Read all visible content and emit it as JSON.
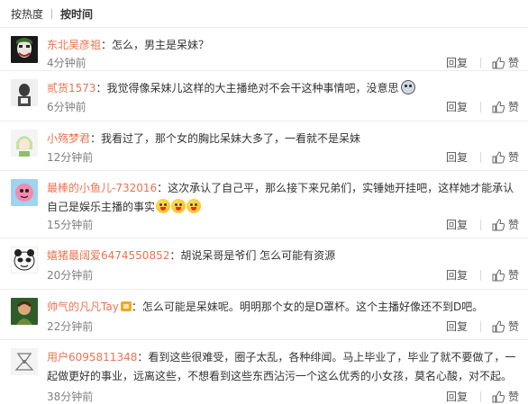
{
  "sort": {
    "hot": "按热度",
    "time": "按时间"
  },
  "comments": [
    {
      "user": "东北吴彦祖",
      "text": "：怎么，男主是呆妹？",
      "time": "4分钟前"
    },
    {
      "user": "贰货1573",
      "text": "：我觉得像呆妹儿这样的大主播绝对不会干这种事情吧，没意思",
      "time": "6分钟前"
    },
    {
      "user": "小殇梦君",
      "text": "：我看过了，那个女的胸比呆妹大多了，一看就不是呆妹",
      "time": "12分钟前"
    },
    {
      "user": "最棒的小鱼儿-732016",
      "text": "：这次承认了自己平，那么接下来兄弟们，实锤她开挂吧，这样她才能承认自己是娱乐主播的事实",
      "time": "15分钟前"
    },
    {
      "user": "嬉猪最阔爱6474550852",
      "text": "：胡说呆哥是爷们 怎么可能有资源",
      "time": "20分钟前"
    },
    {
      "user": "帅气的凡凡Tay",
      "text": "：怎么可能是呆妹呢。明明那个女的是D罩杯。这个主播好像还不到D吧。",
      "time": "22分钟前"
    },
    {
      "user": "用户6095811348",
      "text": "：看到这些很难受，圈子太乱，各种绯闻。马上毕业了，毕业了就不要做了，一起做更好的事业，远离这些，不想看到这些东西沾污一个这么优秀的小女孩，莫名心酸，对不起。",
      "time": "38分钟前"
    }
  ],
  "actions": {
    "reply": "回复",
    "like": "赞"
  },
  "colors": {
    "username": "#eb7350",
    "time": "#808080",
    "text": "#333333",
    "divider": "#ececec"
  },
  "icons": {
    "like": "thumbs-up-icon",
    "emoji": "grin-emoji-icon"
  }
}
